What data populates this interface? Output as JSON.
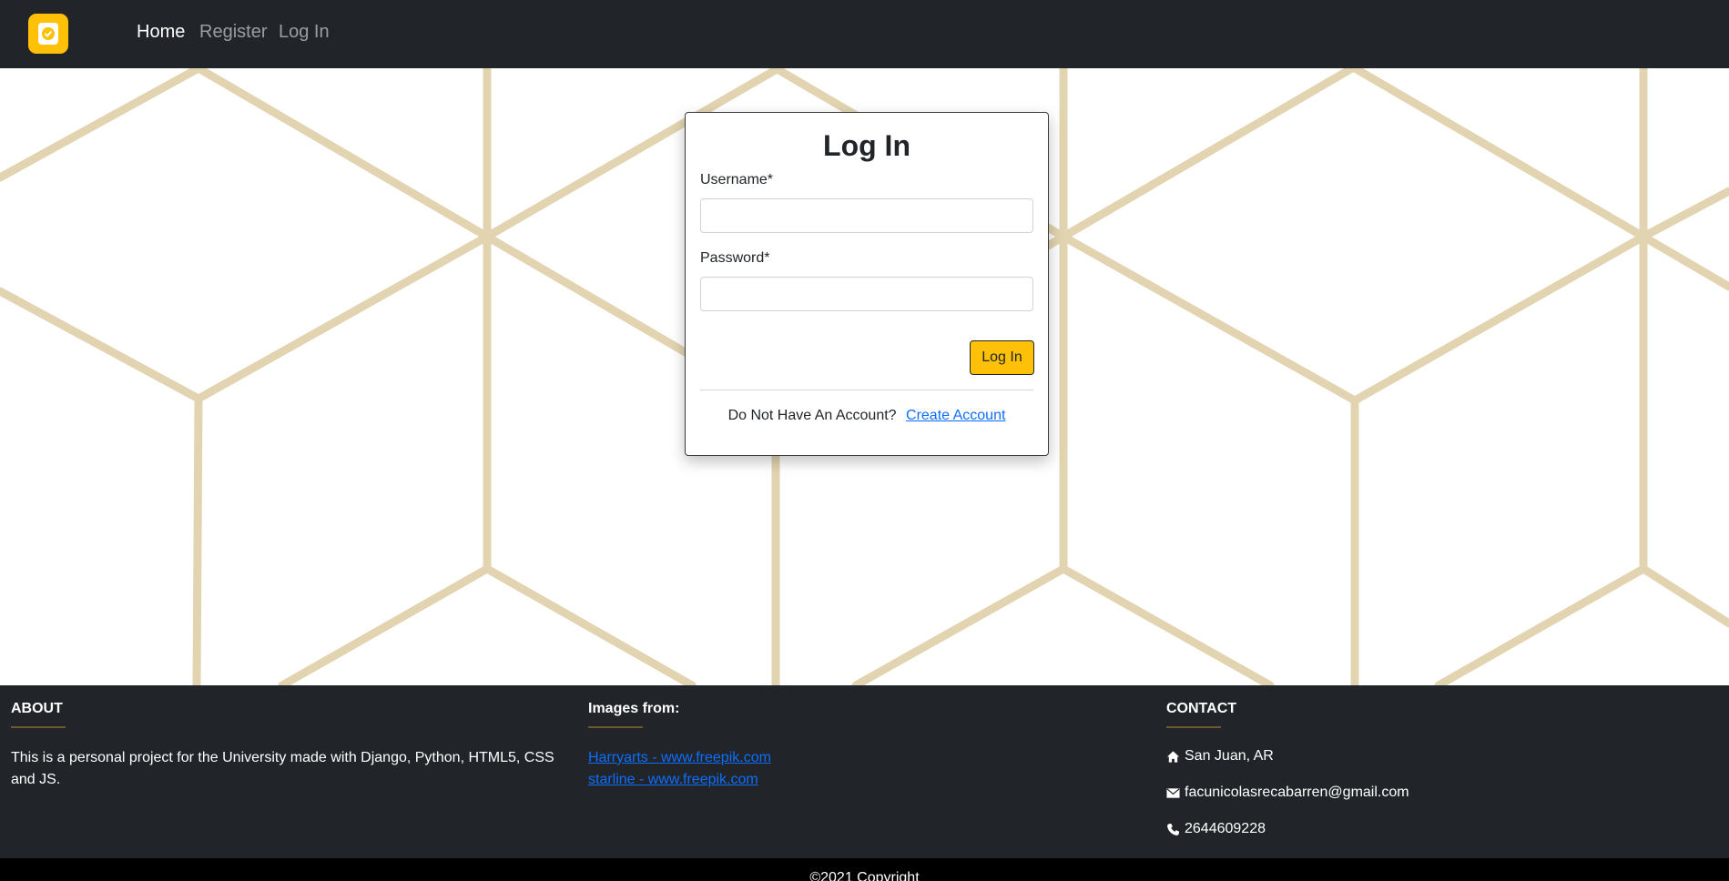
{
  "navbar": {
    "brand_icon": "app-logo-icon",
    "links": [
      {
        "label": "Home",
        "active": true
      },
      {
        "label": "Register",
        "active": false
      },
      {
        "label": "Log In",
        "active": false
      }
    ]
  },
  "login": {
    "title": "Log In",
    "username_label": "Username*",
    "username_value": "",
    "password_label": "Password*",
    "password_value": "",
    "submit_label": "Log In",
    "no_account_text": "Do Not Have An Account?",
    "create_account_label": "Create Account"
  },
  "footer": {
    "about": {
      "heading": "ABOUT",
      "text": "This is a personal project for the University made with Django, Python, HTML5, CSS and JS."
    },
    "images": {
      "heading": "Images from:",
      "links": [
        "Harryarts - www.freepik.com",
        "starline - www.freepik.com"
      ]
    },
    "contact": {
      "heading": "CONTACT",
      "location": "San Juan, AR",
      "email": "facunicolasrecabarren@gmail.com",
      "phone": "2644609228"
    },
    "copyright": "©2021 Copyright"
  },
  "colors": {
    "navbar_bg": "#212529",
    "accent": "#ffc107",
    "pattern": "#e2d4b0",
    "link": "#0d6efd"
  }
}
